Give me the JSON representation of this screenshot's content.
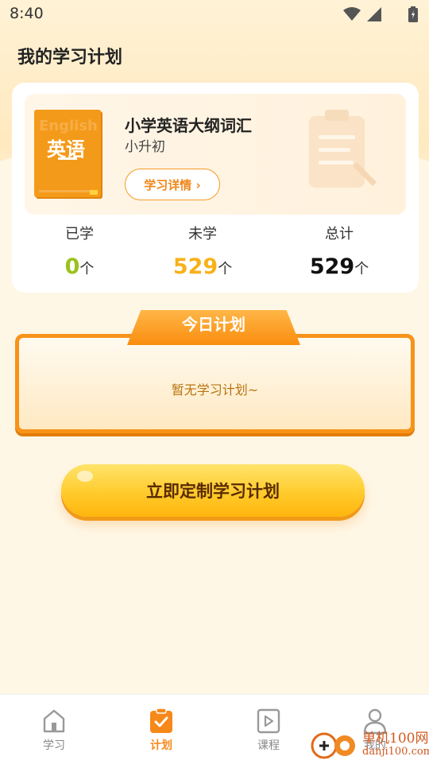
{
  "status_bar": {
    "time": "8:40"
  },
  "page": {
    "title": "我的学习计划"
  },
  "book": {
    "cover_text": "英语",
    "cover_watermark": "English",
    "title": "小学英语大纲词汇",
    "subtitle": "小升初",
    "detail_button": "学习详情 ›"
  },
  "stats": [
    {
      "label": "已学",
      "value": "0",
      "unit": "个",
      "color": "#9bc21c"
    },
    {
      "label": "未学",
      "value": "529",
      "unit": "个",
      "color": "#f7b21a"
    },
    {
      "label": "总计",
      "value": "529",
      "unit": "个",
      "color": "#111111"
    }
  ],
  "today": {
    "title": "今日计划",
    "empty_text": "暂无学习计划~"
  },
  "create_button": "立即定制学习计划",
  "tabs": [
    {
      "label": "学习",
      "icon": "home-icon",
      "active": false
    },
    {
      "label": "计划",
      "icon": "check-clipboard-icon",
      "active": true
    },
    {
      "label": "课程",
      "icon": "play-icon",
      "active": false
    },
    {
      "label": "我的",
      "icon": "user-icon",
      "active": false
    }
  ],
  "watermark": {
    "line1": "单机100网",
    "line2": "danji100.com"
  },
  "colors": {
    "accent": "#f6891a",
    "tab_inactive": "#888888"
  }
}
